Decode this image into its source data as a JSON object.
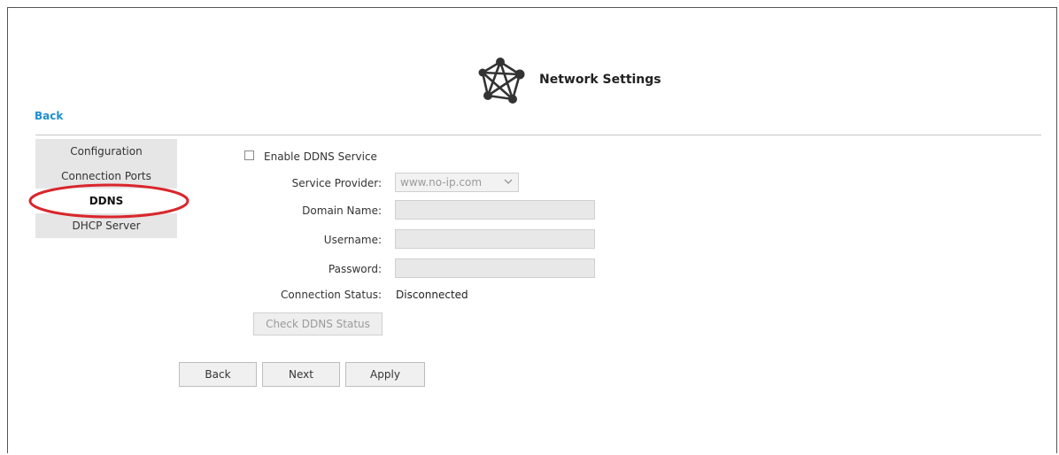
{
  "header": {
    "title": "Network Settings",
    "logo_icon": "network-nodes-icon"
  },
  "back_link": "Back",
  "sidebar": {
    "items": [
      {
        "label": "Configuration"
      },
      {
        "label": "Connection Ports"
      },
      {
        "label": "DDNS",
        "active": true
      },
      {
        "label": "DHCP Server"
      }
    ],
    "highlight_color": "#d9262c"
  },
  "form": {
    "enable_label": "Enable DDNS Service",
    "enable_checked": false,
    "service_provider": {
      "label": "Service Provider:",
      "value": "www.no-ip.com"
    },
    "domain_name": {
      "label": "Domain Name:",
      "value": ""
    },
    "username": {
      "label": "Username:",
      "value": ""
    },
    "password": {
      "label": "Password:",
      "value": ""
    },
    "connection_status": {
      "label": "Connection Status:",
      "value": "Disconnected"
    },
    "check_button": "Check DDNS Status"
  },
  "buttons": {
    "back": "Back",
    "next": "Next",
    "apply": "Apply"
  },
  "colors": {
    "link": "#1f8fd0",
    "sidebar_bg": "#e6e6e6"
  }
}
